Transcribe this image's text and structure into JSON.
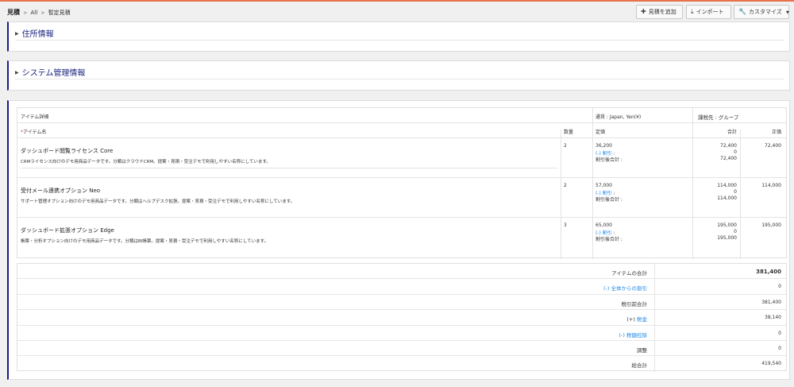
{
  "breadcrumb": {
    "module": "見積",
    "all": "All",
    "current": "暫定見積"
  },
  "toolbar": {
    "add_label": "見積を追加",
    "import_label": "インポート",
    "customize_label": "カスタマイズ"
  },
  "sections": {
    "address": "住所情報",
    "system": "システム管理情報"
  },
  "items_table": {
    "title": "アイテム詳細",
    "currency": "通貨 : Japan, Yen(¥)",
    "tax_mode": "課税先 : グループ",
    "headers": {
      "name": "アイテム名",
      "qty": "数量",
      "list_price": "定価",
      "total": "合計",
      "net": "正価"
    },
    "discount_label": "割引",
    "discount_prefix": "(-)",
    "after_discount_label": "割引後合計 :",
    "rows": [
      {
        "name": "ダッシュボード閲覧ライセンス Core",
        "description": "CRMライセンス向けのデモ用商品データです。分類はクラウドCRM。提案・見積・受注デモで利用しやすい名称にしています。",
        "qty": "2",
        "price": "36,200",
        "total": "72,400",
        "discount": "0",
        "after_discount": "72,400",
        "net": "72,400"
      },
      {
        "name": "受付メール連携オプション Neo",
        "description": "サポート管理オプション向けのデモ用商品データです。分類はヘルプデスク拡張。提案・見積・受注デモで利用しやすい名称にしています。",
        "qty": "2",
        "price": "57,000",
        "total": "114,000",
        "discount": "0",
        "after_discount": "114,000",
        "net": "114,000"
      },
      {
        "name": "ダッシュボード拡張オプション Edge",
        "description": "帳票・分析オプション向けのデモ用商品データです。分類はBI帳票。提案・見積・受注デモで利用しやすい名称にしています。",
        "qty": "3",
        "price": "65,000",
        "total": "195,000",
        "discount": "0",
        "after_discount": "195,000",
        "net": "195,000"
      }
    ]
  },
  "totals": {
    "items_total": {
      "label": "アイテムの合計",
      "value": "381,400"
    },
    "overall_discount": {
      "prefix": "(-)",
      "label": "全体からの割引",
      "value": "0"
    },
    "pre_tax": {
      "label": "税引前合計",
      "value": "381,400"
    },
    "tax": {
      "prefix": "(+)",
      "label": "税金",
      "value": "38,140"
    },
    "tax_deduction": {
      "prefix": "(-)",
      "label": "税額控除",
      "value": "0"
    },
    "adjustment": {
      "label": "調整",
      "value": "0"
    },
    "grand_total": {
      "label": "総合計",
      "value": "419,540"
    }
  },
  "colors": {
    "accent_border": "#1a1a8c",
    "top_bar": "#e8724a",
    "link": "#1e88e5",
    "required": "#e53935"
  }
}
